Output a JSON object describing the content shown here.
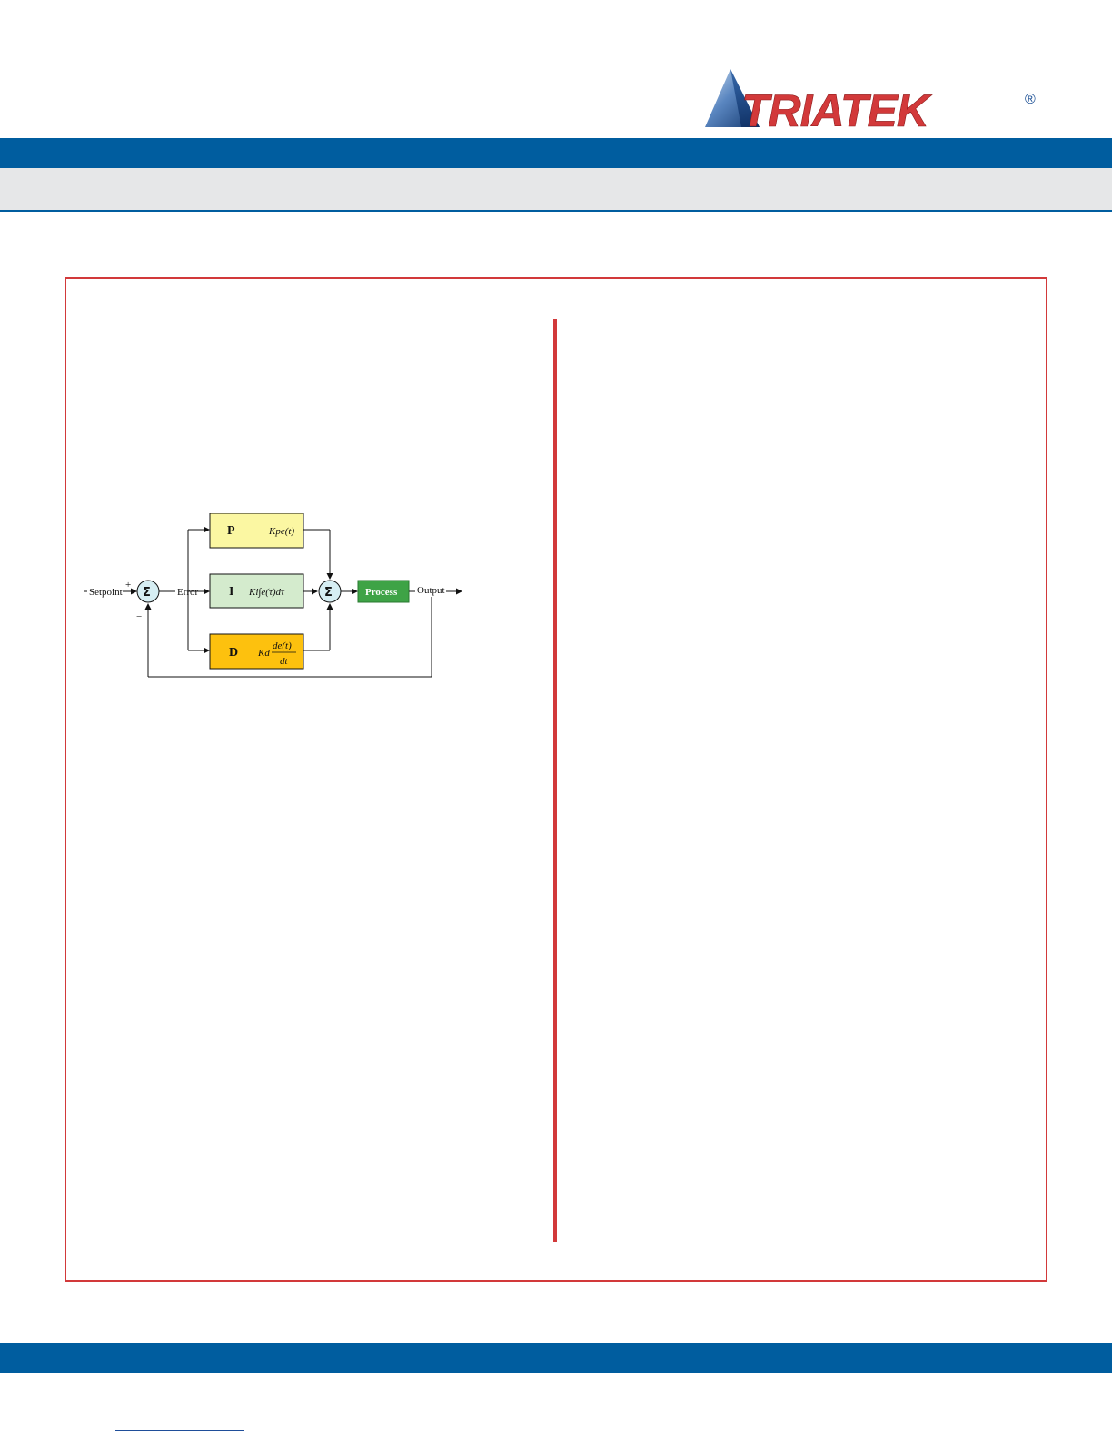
{
  "brand": {
    "name": "TRIATEK",
    "reg_mark": "®",
    "accent_color": "#005d9f",
    "frame_color": "#d2393a"
  },
  "diagram": {
    "setpoint_label": "Setpoint",
    "plus_sign": "+",
    "minus_sign": "−",
    "sum_symbol": "Σ",
    "error_label": "Error",
    "p_block": {
      "letter": "P",
      "formula": "Kpe(t)",
      "color": "#fbf7a2"
    },
    "i_block": {
      "letter": "I",
      "formula": "Ki∫e(τ)dτ",
      "color": "#d4ebcd"
    },
    "d_block": {
      "letter": "D",
      "numerator": "de(t)",
      "denominator": "dt",
      "coef": "Kd",
      "color": "#fdc10e"
    },
    "process_label": "Process",
    "process_color": "#3ea346",
    "output_label": "Output"
  }
}
